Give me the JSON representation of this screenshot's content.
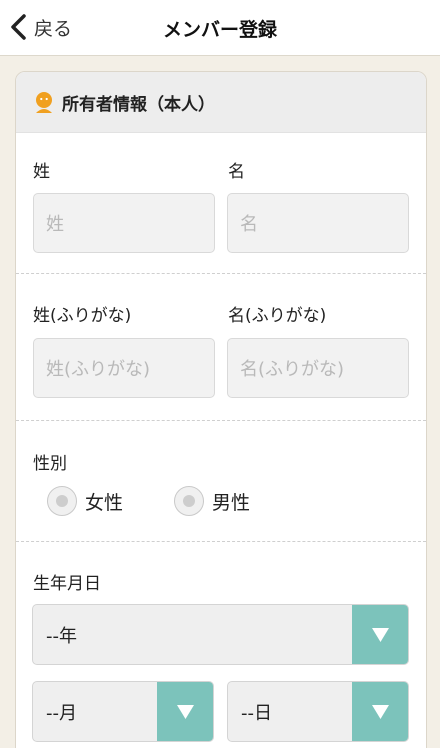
{
  "navbar": {
    "back_label": "戻る",
    "title": "メンバー登録"
  },
  "owner_section": {
    "title": "所有者情報（本人）",
    "last_name": {
      "label": "姓",
      "placeholder": "姓"
    },
    "first_name": {
      "label": "名",
      "placeholder": "名"
    },
    "last_name_kana": {
      "label": "姓(ふりがな)",
      "placeholder": "姓(ふりがな)"
    },
    "first_name_kana": {
      "label": "名(ふりがな)",
      "placeholder": "名(ふりがな)"
    },
    "gender": {
      "label": "性別",
      "options": [
        "女性",
        "男性"
      ]
    },
    "birthdate": {
      "label": "生年月日",
      "year": "--年",
      "month": "--月",
      "day": "--日"
    }
  },
  "colors": {
    "accent": "#7cc3bb",
    "page_background": "#f3efe6",
    "header_icon": "#f0a020"
  },
  "icons": {
    "back": "chevron-left-icon",
    "header": "person-icon",
    "dropdown": "triangle-down-icon"
  }
}
